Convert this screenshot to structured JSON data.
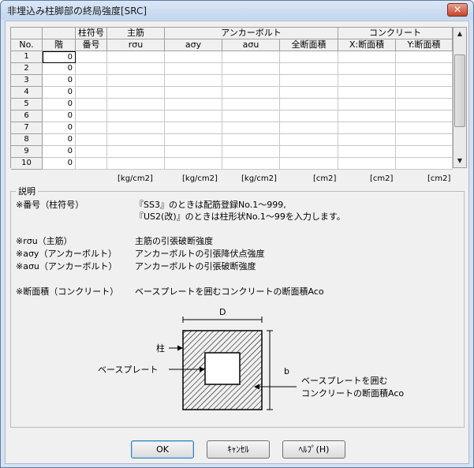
{
  "window": {
    "title": "非埋込み柱脚部の終局強度[SRC]",
    "close_glyph": "✕"
  },
  "table": {
    "group_headers": {
      "column_code": "柱符号",
      "main_rebar": "主筋",
      "anchor_bolt": "アンカーボルト",
      "concrete": "コンクリート"
    },
    "column_headers": {
      "no": "No.",
      "floor": "階",
      "number": "番号",
      "r_sigma_u": "rσu",
      "a_sigma_y": "aσy",
      "a_sigma_u": "aσu",
      "total_area": "全断面積",
      "x_area": "X:断面積",
      "y_area": "Y:断面積"
    },
    "rows": [
      {
        "no": "1",
        "floor": "0"
      },
      {
        "no": "2",
        "floor": "0"
      },
      {
        "no": "3",
        "floor": "0"
      },
      {
        "no": "4",
        "floor": "0"
      },
      {
        "no": "5",
        "floor": "0"
      },
      {
        "no": "6",
        "floor": "0"
      },
      {
        "no": "7",
        "floor": "0"
      },
      {
        "no": "8",
        "floor": "0"
      },
      {
        "no": "9",
        "floor": "0"
      },
      {
        "no": "10",
        "floor": "0"
      }
    ],
    "units": [
      "[kg/cm2]",
      "[kg/cm2]",
      "[kg/cm2]",
      "[cm2]",
      "[cm2]",
      "[cm2]"
    ]
  },
  "description": {
    "legend": "説明",
    "lines": [
      "※番号（柱符号）",
      "『SS3』のときは配筋登録No.1～999,",
      "『US2(改)』のときは柱形状No.1～99を入力します。",
      "※rσu（主筋）",
      "主筋の引張破断強度",
      "※aσy（アンカーボルト）",
      "アンカーボルトの引張降伏点強度",
      "※aσu（アンカーボルト）",
      "アンカーボルトの引張破断強度",
      "※断面積（コンクリート）",
      "ベースプレートを囲むコンクリートの断面積Aco"
    ],
    "diagram": {
      "dim_d": "D",
      "dim_b": "b",
      "label_column": "柱",
      "label_baseplate": "ベースプレート",
      "label_concrete_1": "ベースプレートを囲む",
      "label_concrete_2": "コンクリートの断面積Aco"
    }
  },
  "buttons": {
    "ok": "OK",
    "cancel": "ｷｬﾝｾﾙ",
    "help": "ﾍﾙﾌﾟ(H)"
  },
  "colors": {
    "title_bg": "#c3d6ef",
    "close_red": "#c7432a",
    "client_bg": "#f0f0f0"
  }
}
